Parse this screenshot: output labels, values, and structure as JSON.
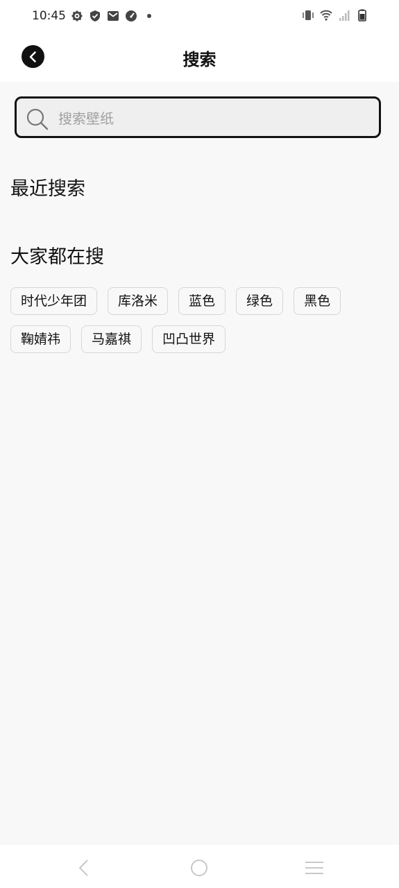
{
  "status_bar": {
    "time": "10:45"
  },
  "header": {
    "title": "搜索"
  },
  "search": {
    "placeholder": "搜索壁纸",
    "value": ""
  },
  "recent": {
    "title": "最近搜索"
  },
  "popular": {
    "title": "大家都在搜",
    "tags": [
      "时代少年团",
      "库洛米",
      "蓝色",
      "绿色",
      "黑色",
      "鞠婧祎",
      "马嘉祺",
      "凹凸世界"
    ]
  }
}
